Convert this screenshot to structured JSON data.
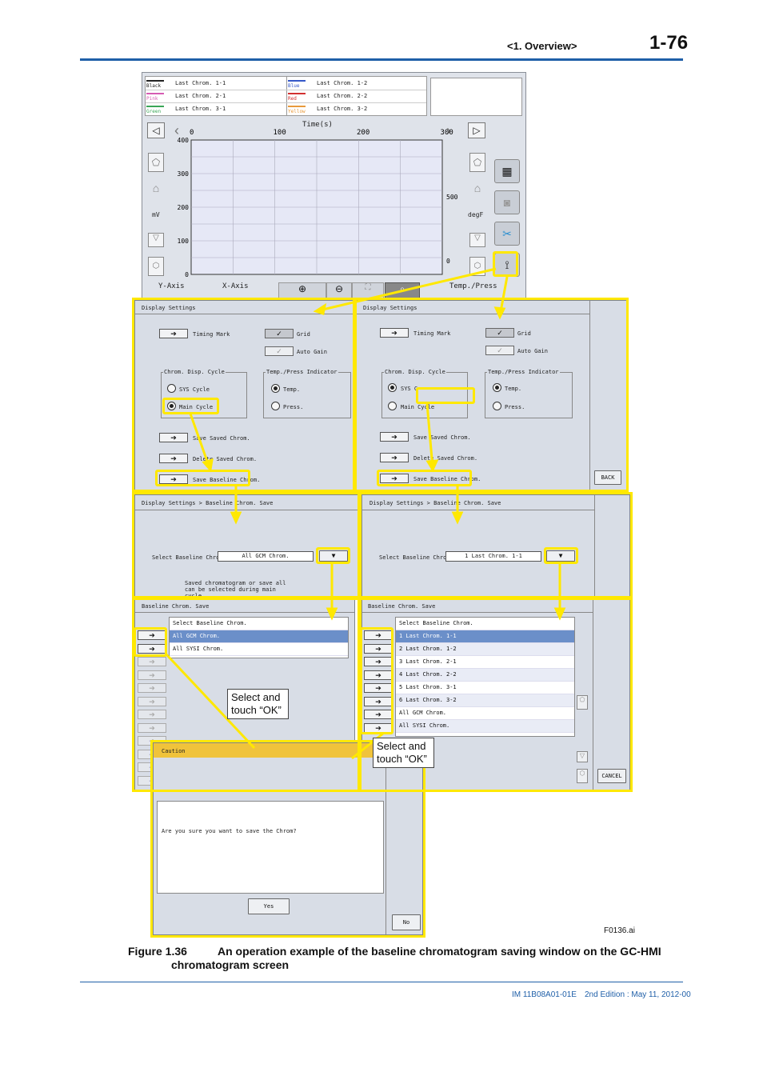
{
  "header": {
    "section": "<1. Overview>",
    "page": "1-76"
  },
  "chrom_screen": {
    "legend": [
      {
        "color_name": "Black",
        "label": "Last Chrom. 1-1",
        "color": "#222222"
      },
      {
        "color_name": "Blue",
        "label": "Last Chrom. 1-2",
        "color": "#3457c8"
      },
      {
        "color_name": "Pink",
        "label": "Last Chrom. 2-1",
        "color": "#d65bb3"
      },
      {
        "color_name": "Red",
        "label": "Last Chrom. 2-2",
        "color": "#d23030"
      },
      {
        "color_name": "Green",
        "label": "Last Chrom. 3-1",
        "color": "#3aa657"
      },
      {
        "color_name": "Yellow",
        "label": "Last Chrom. 3-2",
        "color": "#e89a3b"
      }
    ],
    "x_title": "Time(s)",
    "x_ticks": [
      "0",
      "100",
      "200",
      "300"
    ],
    "y_ticks": [
      "400",
      "300",
      "200",
      "100",
      "0"
    ],
    "y_unit": "mV",
    "y2_ticks": [
      "500",
      "0"
    ],
    "y2_unit": "degF",
    "y_axis_label": "Y-Axis",
    "x_axis_label": "X-Axis",
    "temp_label": "Temp./Press"
  },
  "display_settings": {
    "title": "Display Settings",
    "timing_mark": "Timing Mark",
    "grid": "Grid",
    "auto_gain": "Auto Gain",
    "cycle_group": "Chrom. Disp. Cycle",
    "sys_cycle": "SYS Cycle",
    "main_cycle": "Main Cycle",
    "indicator_group": "Temp./Press Indicator",
    "temp": "Temp.",
    "press": "Press.",
    "save_saved": "Save Saved Chrom.",
    "delete_saved": "Delete Saved Chrom.",
    "save_baseline": "Save Baseline Chrom.",
    "back": "BACK",
    "sys_cycle_partial": "SYS C"
  },
  "baseline_save": {
    "title": "Display Settings > Baseline Chrom. Save",
    "select_label": "Select Baseline Chrom.",
    "left_value": "All GCM Chrom.",
    "right_value": "1 Last Chrom. 1-1",
    "note": "Saved chromatogram or save all can be selected during main cycle."
  },
  "selection": {
    "title": "Baseline Chrom. Save",
    "header": "Select Baseline Chrom.",
    "left_items": [
      "All GCM Chrom.",
      "All SYSI Chrom."
    ],
    "right_items": [
      "1 Last Chrom. 1-1",
      "2 Last Chrom. 1-2",
      "3 Last Chrom. 2-1",
      "4 Last Chrom. 2-2",
      "5 Last Chrom. 3-1",
      "6 Last Chrom. 3-2",
      "All GCM Chrom.",
      "All SYSI Chrom."
    ],
    "cancel": "CANCEL"
  },
  "caution": {
    "title": "Caution",
    "message": "Are you sure you want to save the Chrom?",
    "yes": "Yes",
    "no": "No"
  },
  "callouts": {
    "left": "Select and touch “OK”",
    "right": "Select and touch “OK”"
  },
  "figure": {
    "file": "F0136.ai",
    "number": "Figure 1.36",
    "caption_line1": "An operation example of the baseline chromatogram saving window on the GC-HMI",
    "caption_line2": "chromatogram screen"
  },
  "footer": {
    "doc": "IM 11B08A01-01E",
    "edition": "2nd Edition : May 11, 2012-00"
  }
}
